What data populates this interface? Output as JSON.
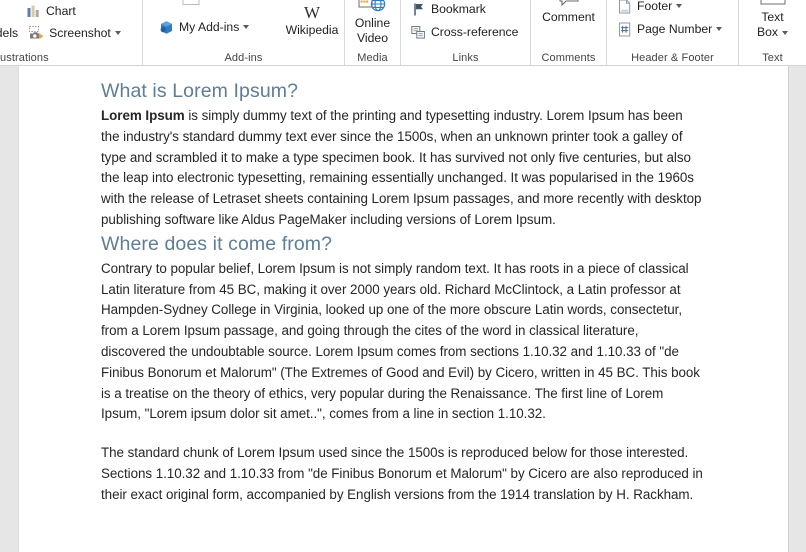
{
  "ribbon": {
    "groups": [
      {
        "name": "illustrations",
        "label": "ustrations",
        "items": [
          {
            "name": "chart",
            "label": "Chart",
            "icon": "bar-chart-icon",
            "has_caret": false
          },
          {
            "name": "models",
            "label": "odels",
            "icon": "3d-models-icon",
            "has_caret": false
          },
          {
            "name": "screenshot",
            "label": "Screenshot",
            "icon": "camera-icon",
            "has_caret": true
          }
        ]
      },
      {
        "name": "add-ins",
        "label": "Add-ins",
        "items": [
          {
            "name": "get-add-ins",
            "label": "",
            "icon": "store-icon",
            "has_caret": false
          },
          {
            "name": "my-add-ins",
            "label": "My Add-ins",
            "icon": "addins-cube-icon",
            "has_caret": true
          },
          {
            "name": "wikipedia",
            "label": "Wikipedia",
            "icon": "wikipedia-w-icon",
            "has_caret": false
          }
        ]
      },
      {
        "name": "media",
        "label": "Media",
        "items": [
          {
            "name": "online-video",
            "label_line1": "Online",
            "label_line2": "Video",
            "icon": "online-video-icon",
            "has_caret": false
          }
        ]
      },
      {
        "name": "links",
        "label": "Links",
        "items": [
          {
            "name": "bookmark",
            "label": "Bookmark",
            "icon": "bookmark-flag-icon",
            "has_caret": false
          },
          {
            "name": "cross-reference",
            "label": "Cross-reference",
            "icon": "cross-reference-icon",
            "has_caret": false
          }
        ]
      },
      {
        "name": "comments",
        "label": "Comments",
        "items": [
          {
            "name": "comment",
            "label": "Comment",
            "icon": "comment-bubble-icon",
            "has_caret": false
          }
        ]
      },
      {
        "name": "header-footer",
        "label": "Header & Footer",
        "items": [
          {
            "name": "footer",
            "label": "Footer",
            "icon": "footer-page-icon",
            "has_caret": true
          },
          {
            "name": "page-number",
            "label": "Page Number",
            "icon": "page-number-icon",
            "has_caret": true
          }
        ]
      },
      {
        "name": "text",
        "label": "Text",
        "items": [
          {
            "name": "text-box",
            "label_line1": "Text",
            "label_line2": "Box",
            "icon": "text-box-icon",
            "has_caret": true
          },
          {
            "name": "word-art",
            "label": "",
            "icon": "word-art-a-icon",
            "has_caret": true
          },
          {
            "name": "signature-line",
            "label": "",
            "icon": "signature-line-icon",
            "has_caret": true
          },
          {
            "name": "date-and-time",
            "label": "",
            "icon": "date-time-icon",
            "has_caret": false
          },
          {
            "name": "object",
            "label": "",
            "icon": "object-icon",
            "has_caret": false
          }
        ]
      }
    ]
  },
  "document": {
    "sections": [
      {
        "heading": "What is Lorem Ipsum?",
        "paragraphs": [
          {
            "lead": "Lorem Ipsum",
            "body": " is simply dummy text of the printing and typesetting industry. Lorem Ipsum has been the industry's standard dummy text ever since the 1500s, when an unknown printer took a galley of type and scrambled it to make a type specimen book. It has survived not only five centuries, but also the leap into electronic typesetting, remaining essentially unchanged. It was popularised in the 1960s with the release of Letraset sheets containing Lorem Ipsum passages, and more recently with desktop publishing software like Aldus PageMaker including versions of Lorem Ipsum."
          }
        ]
      },
      {
        "heading": "Where does it come from?",
        "paragraphs": [
          {
            "lead": "",
            "body": "Contrary to popular belief, Lorem Ipsum is not simply random text. It has roots in a piece of classical Latin literature from 45 BC, making it over 2000 years old. Richard McClintock, a Latin professor at Hampden-Sydney College in Virginia, looked up one of the more obscure Latin words, consectetur, from a Lorem Ipsum passage, and going through the cites of the word in classical literature, discovered the undoubtable source. Lorem Ipsum comes from sections 1.10.32 and 1.10.33 of \"de Finibus Bonorum et Malorum\" (The Extremes of Good and Evil) by Cicero, written in 45 BC. This book is a treatise on the theory of ethics, very popular during the Renaissance. The first line of Lorem Ipsum, \"Lorem ipsum dolor sit amet..\", comes from a line in section 1.10.32."
          },
          {
            "lead": "",
            "body": "The standard chunk of Lorem Ipsum used since the 1500s is reproduced below for those interested. Sections 1.10.32 and 1.10.33 from \"de Finibus Bonorum et Malorum\" by Cicero are also reproduced in their exact original form, accompanied by English versions from the 1914 translation by H. Rackham."
          }
        ]
      }
    ]
  },
  "colors": {
    "heading": "#5f7d95",
    "body_text": "#262626",
    "ribbon_label": "#444444",
    "canvas_background": "#e6e6e6",
    "page_background": "#ffffff",
    "accent_blue": "#1f6fb5"
  }
}
